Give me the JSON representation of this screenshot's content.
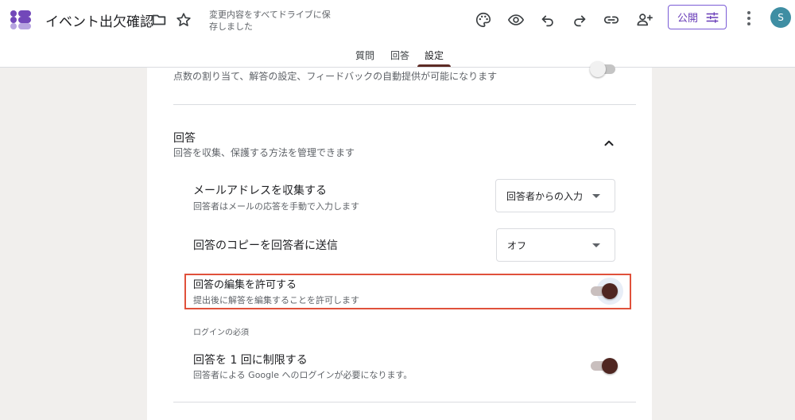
{
  "header": {
    "doc_title": "イベント出欠確認",
    "save_status": "変更内容をすべてドライブに保存しました",
    "publish_label": "公開",
    "avatar_initial": "S",
    "icons": [
      "folder-icon",
      "star-icon",
      "palette-icon",
      "preview-eye-icon",
      "undo-icon",
      "redo-icon",
      "link-icon",
      "add-collaborator-icon",
      "tune-icon",
      "more-vert-icon"
    ],
    "accent_color": "#673ab7"
  },
  "tabs": [
    {
      "label": "質問"
    },
    {
      "label": "回答"
    },
    {
      "label": "設定"
    }
  ],
  "active_tab": "設定",
  "quiz_section": {
    "description": "点数の割り当て、解答の設定、フィードバックの自動提供が可能になります",
    "toggle_on": false
  },
  "responses_section": {
    "title": "回答",
    "description": "回答を収集、保護する方法を管理できます",
    "expanded": true,
    "settings": [
      {
        "label": "メールアドレスを収集する",
        "description": "回答者はメールの応答を手動で入力します",
        "control": "select",
        "value": "回答者からの入力"
      },
      {
        "label": "回答のコピーを回答者に送信",
        "description": "",
        "control": "select",
        "value": "オフ"
      },
      {
        "label": "回答の編集を許可する",
        "description": "提出後に解答を編集することを許可します",
        "control": "toggle",
        "toggle_on": true
      }
    ],
    "login_group_label": "ログインの必須",
    "login_setting": {
      "label": "回答を 1 回に制限する",
      "description": "回答者による Google へのログインが必要になります。",
      "toggle_on": true
    }
  }
}
